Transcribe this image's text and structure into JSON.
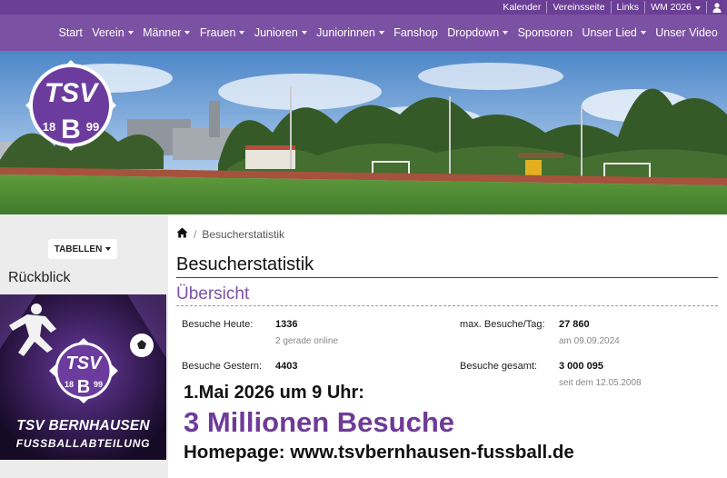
{
  "topbar": {
    "items": [
      "Kalender",
      "Vereinsseite",
      "Links",
      "WM 2026"
    ]
  },
  "nav": {
    "items": [
      {
        "label": "Start",
        "dropdown": false
      },
      {
        "label": "Verein",
        "dropdown": true
      },
      {
        "label": "Männer",
        "dropdown": true
      },
      {
        "label": "Frauen",
        "dropdown": true
      },
      {
        "label": "Junioren",
        "dropdown": true
      },
      {
        "label": "Juniorinnen",
        "dropdown": true
      },
      {
        "label": "Fanshop",
        "dropdown": false
      },
      {
        "label": "Dropdown",
        "dropdown": true
      },
      {
        "label": "Sponsoren",
        "dropdown": false
      },
      {
        "label": "Unser Lied",
        "dropdown": true
      },
      {
        "label": "Unser Video",
        "dropdown": false
      }
    ]
  },
  "logo": {
    "text": "TSV",
    "year_left": "18",
    "year_right": "99",
    "letter": "B"
  },
  "sidebar": {
    "tabellen_label": "TABELLEN",
    "rueckblick_label": "Rückblick"
  },
  "promo": {
    "line1": "TSV BERNHAUSEN",
    "line2": "FUSSBALLABTEILUNG"
  },
  "breadcrumb": {
    "current": "Besucherstatistik"
  },
  "page": {
    "title": "Besucherstatistik",
    "subtitle": "Übersicht"
  },
  "stats": {
    "heute_label": "Besuche Heute:",
    "heute_value": "1336",
    "online": "2 gerade online",
    "gestern_label": "Besuche Gestern:",
    "gestern_value": "4403",
    "max_label": "max. Besuche/Tag:",
    "max_value": "27 860",
    "max_date": "am 09.09.2024",
    "gesamt_label": "Besuche gesamt:",
    "gesamt_value": "3 000 095",
    "gesamt_since": "seit dem 12.05.2008"
  },
  "announcement": {
    "line1": "1.Mai 2026 um 9 Uhr:",
    "line2": "3 Millionen Besuche",
    "line3": "Homepage: www.tsvbernhausen-fussball.de"
  },
  "colors": {
    "brand_purple": "#7b52a3",
    "topbar_purple": "#6a3f95",
    "headline_purple": "#6e3b98"
  }
}
